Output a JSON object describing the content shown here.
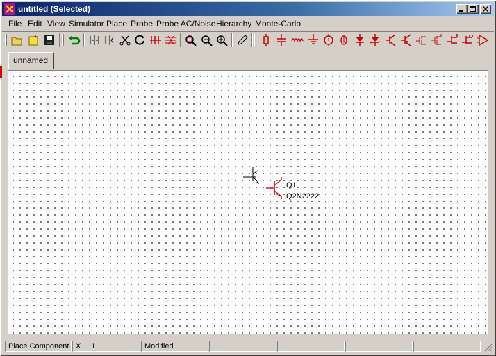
{
  "window": {
    "title": "untitled (Selected)"
  },
  "menu": {
    "file": "File",
    "edit": "Edit",
    "view": "View",
    "simulator": "Simulator",
    "place": "Place",
    "probe": "Probe",
    "probe_ac_noise": "Probe AC/Noise",
    "hierarchy": "Hierarchy",
    "monte_carlo": "Monte-Carlo"
  },
  "tabs": [
    {
      "label": "unnamed"
    }
  ],
  "component": {
    "ref": "Q1",
    "model": "Q2N2222"
  },
  "status": {
    "mode": "Place Component",
    "coord_label": "X",
    "coord_value": "1",
    "state": "Modified"
  },
  "colors": {
    "accent_red": "#cc0000",
    "title_blue": "#0a246a",
    "toolbar_green": "#008000"
  }
}
